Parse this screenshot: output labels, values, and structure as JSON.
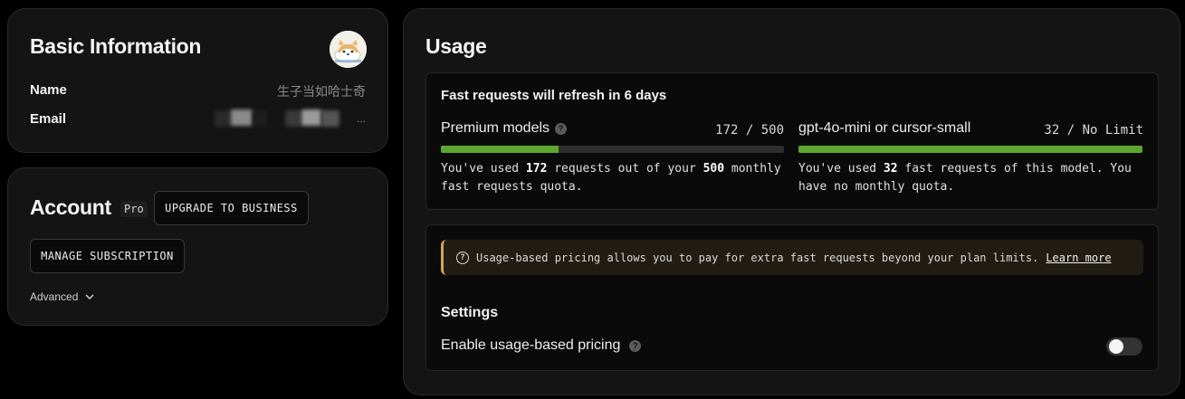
{
  "basic": {
    "title": "Basic Information",
    "name_label": "Name",
    "name_value": "生子当如哈士奇",
    "email_label": "Email",
    "email_suffix": "..."
  },
  "account": {
    "title": "Account",
    "plan_badge": "Pro",
    "upgrade_label": "UPGRADE TO BUSINESS",
    "manage_label": "MANAGE SUBSCRIPTION",
    "advanced_label": "Advanced"
  },
  "usage": {
    "title": "Usage",
    "refresh_text": "Fast requests will refresh in 6 days",
    "premium": {
      "name": "Premium models",
      "used": 172,
      "limit": 500,
      "count_text": "172 / 500",
      "progress_fraction": 0.344,
      "desc_pre": "You've used ",
      "desc_used": "172",
      "desc_mid": " requests out of your ",
      "desc_limit": "500",
      "desc_post": " monthly fast requests quota."
    },
    "mini": {
      "name": "gpt-4o-mini or cursor-small",
      "count_text": "32 / No Limit",
      "progress_fraction": 1.0,
      "desc_pre": "You've used ",
      "desc_used": "32",
      "desc_post": " fast requests of this model. You have no monthly quota."
    },
    "notice_text": "Usage-based pricing allows you to pay for extra fast requests beyond your plan limits.",
    "learn_more": "Learn more",
    "settings_title": "Settings",
    "enable_label": "Enable usage-based pricing",
    "usage_based_enabled": false
  },
  "colors": {
    "progress": "#5fa62f",
    "notice_border": "#d6a64d",
    "background": "#000000",
    "card": "#141414"
  }
}
